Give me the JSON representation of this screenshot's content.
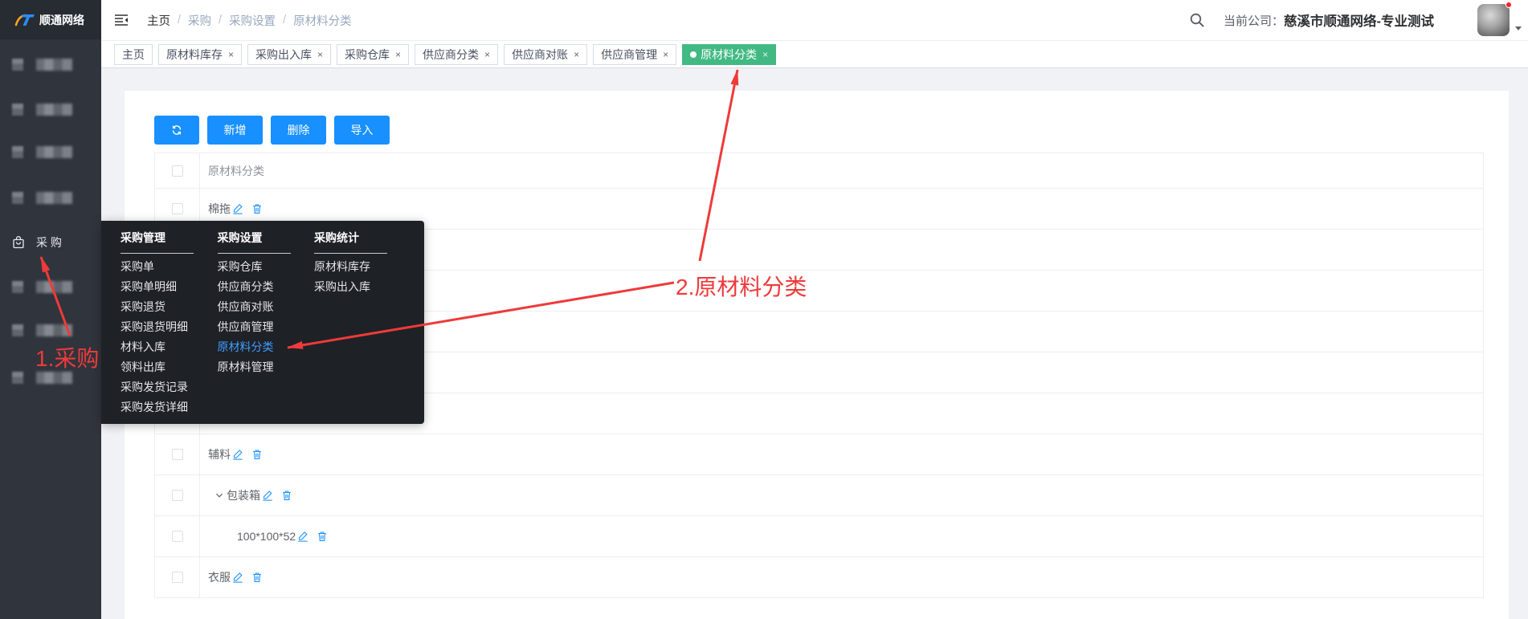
{
  "app": {
    "logo_text": "顺通网络",
    "logo_icon": "shuntong-logo-icon"
  },
  "sidebar": {
    "current_item": {
      "label": "采 购",
      "icon": "shopping-bag-icon"
    }
  },
  "header": {
    "menu_toggle_icon": "hamburger-icon",
    "breadcrumb": [
      {
        "label": "主页"
      },
      {
        "label": "采购"
      },
      {
        "label": "采购设置"
      },
      {
        "label": "原材料分类"
      }
    ],
    "breadcrumb_separator": "/",
    "search_icon": "search-icon",
    "company_label": "当前公司：",
    "company_name": "慈溪市顺通网络-专业测试"
  },
  "tag_close_glyph": "×",
  "tags": [
    {
      "label": "主页",
      "closable": false,
      "active": false
    },
    {
      "label": "原材料库存",
      "closable": true,
      "active": false
    },
    {
      "label": "采购出入库",
      "closable": true,
      "active": false
    },
    {
      "label": "采购仓库",
      "closable": true,
      "active": false
    },
    {
      "label": "供应商分类",
      "closable": true,
      "active": false
    },
    {
      "label": "供应商对账",
      "closable": true,
      "active": false
    },
    {
      "label": "供应商管理",
      "closable": true,
      "active": false
    },
    {
      "label": "原材料分类",
      "closable": true,
      "active": true
    }
  ],
  "toolbar": {
    "refresh_icon": "refresh-icon",
    "add_label": "新增",
    "delete_label": "删除",
    "import_label": "导入"
  },
  "table": {
    "column_header": "原材料分类",
    "rows": [
      {
        "name": "棉拖",
        "level": 0
      },
      {
        "name": null,
        "level": 0
      },
      {
        "name": null,
        "level": 0
      },
      {
        "name": null,
        "level": 0
      },
      {
        "name": null,
        "level": 0
      },
      {
        "name": null,
        "level": 0
      },
      {
        "name": "辅料",
        "level": 0
      },
      {
        "name": "包装箱",
        "level": 0,
        "expanded": true
      },
      {
        "name": "100*100*52",
        "level": 1
      },
      {
        "name": "衣服",
        "level": 0
      }
    ]
  },
  "mega_menu": {
    "columns": [
      {
        "title": "采购管理",
        "items": [
          {
            "label": "采购单"
          },
          {
            "label": "采购单明细"
          },
          {
            "label": "采购退货"
          },
          {
            "label": "采购退货明细"
          },
          {
            "label": "材料入库"
          },
          {
            "label": "领料出库"
          },
          {
            "label": "采购发货记录"
          },
          {
            "label": "采购发货详细"
          }
        ]
      },
      {
        "title": "采购设置",
        "items": [
          {
            "label": "采购仓库"
          },
          {
            "label": "供应商分类"
          },
          {
            "label": "供应商对账"
          },
          {
            "label": "供应商管理"
          },
          {
            "label": "原材料分类",
            "active": true
          },
          {
            "label": "原材料管理"
          }
        ]
      },
      {
        "title": "采购统计",
        "items": [
          {
            "label": "原材料库存"
          },
          {
            "label": "采购出入库"
          }
        ]
      }
    ]
  },
  "annotations": {
    "step1": "1.采购",
    "step2": "2.原材料分类"
  },
  "colors": {
    "sidebar_bg": "#30343c",
    "logo_bg": "#272b32",
    "primary": "#1890ff",
    "active_tag": "#42b983",
    "annotation": "#ee3a3a",
    "menu_bg": "#1e2126",
    "menu_active": "#409eff"
  }
}
